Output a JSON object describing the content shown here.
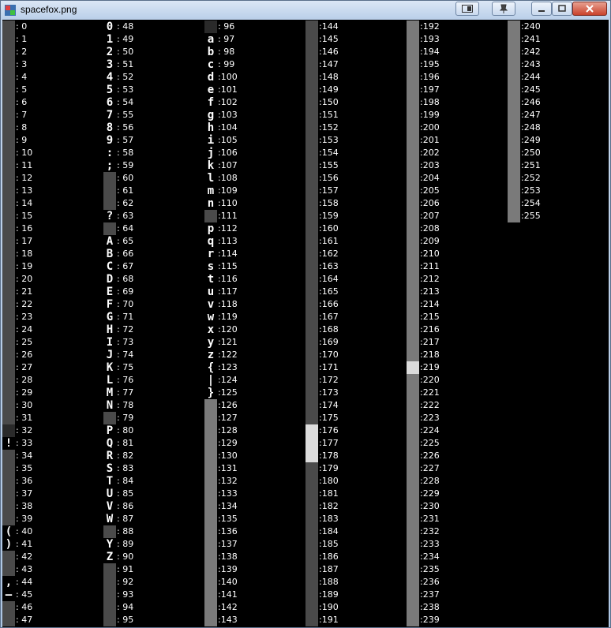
{
  "window": {
    "title": "spacefox.png",
    "buttons": {
      "fullscreen_icon": "window-toggle-icon",
      "pin_icon": "pin-icon",
      "minimize_icon": "minimize-icon",
      "maximize_icon": "maximize-icon",
      "close_icon": "close-icon"
    }
  },
  "tileset": {
    "glyphs": {
      "48": "0",
      "49": "1",
      "50": "2",
      "51": "3",
      "52": "4",
      "53": "5",
      "54": "6",
      "55": "7",
      "56": "8",
      "57": "9",
      "58": ":",
      "59": ";",
      "63": "?",
      "65": "A",
      "66": "B",
      "67": "C",
      "68": "D",
      "69": "E",
      "70": "F",
      "71": "G",
      "72": "H",
      "73": "I",
      "74": "J",
      "75": "K",
      "76": "L",
      "77": "M",
      "78": "N",
      "80": "P",
      "81": "Q",
      "82": "R",
      "83": "S",
      "84": "T",
      "85": "U",
      "86": "V",
      "87": "W",
      "89": "Y",
      "90": "Z",
      "97": "a",
      "98": "b",
      "99": "c",
      "100": "d",
      "101": "e",
      "102": "f",
      "103": "g",
      "104": "h",
      "105": "i",
      "106": "j",
      "107": "k",
      "108": "l",
      "109": "m",
      "110": "n",
      "112": "p",
      "113": "q",
      "114": "r",
      "115": "s",
      "116": "t",
      "117": "u",
      "118": "v",
      "119": "w",
      "120": "x",
      "121": "y",
      "122": "z",
      "123": "{",
      "124": "|",
      "125": "}",
      "33": "!",
      "40": "(",
      "41": ")",
      "44": ",",
      "45": "—"
    },
    "labels": [
      ": 0",
      ": 1",
      ": 2",
      ": 3",
      ": 4",
      ": 5",
      ": 6",
      ": 7",
      ": 8",
      ": 9",
      ": 10",
      ": 11",
      ": 12",
      ": 13",
      ": 14",
      ": 15",
      ": 16",
      ": 17",
      ": 18",
      ": 19",
      ": 20",
      ": 21",
      ": 22",
      ": 23",
      ": 24",
      ": 25",
      ": 26",
      ": 27",
      ": 28",
      ": 29",
      ": 30",
      ": 31",
      ": 32",
      ": 33",
      ": 34",
      ": 35",
      ": 36",
      ": 37",
      ": 38",
      ": 39",
      ": 40",
      ": 41",
      ": 42",
      ": 43",
      ": 44",
      ": 45",
      ": 46",
      ": 47",
      ": 48",
      ": 49",
      ": 50",
      ": 51",
      ": 52",
      ": 53",
      ": 54",
      ": 55",
      ": 56",
      ": 57",
      ": 58",
      ": 59",
      ": 60",
      ": 61",
      ": 62",
      ": 63",
      ": 64",
      ": 65",
      ": 66",
      ": 67",
      ": 68",
      ": 69",
      ": 70",
      ": 71",
      ": 72",
      ": 73",
      ": 74",
      ": 75",
      ": 76",
      ": 77",
      ": 78",
      ": 79",
      ": 80",
      ": 81",
      ": 82",
      ": 83",
      ": 84",
      ": 85",
      ": 86",
      ": 87",
      ": 88",
      ": 89",
      ": 90",
      ": 91",
      ": 92",
      ": 93",
      ": 94",
      ": 95",
      ": 96",
      ": 97",
      ": 98",
      ": 99",
      ":100",
      ":101",
      ":102",
      ":103",
      ":104",
      ":105",
      ":106",
      ":107",
      ":108",
      ":109",
      ":110",
      ":111",
      ":112",
      ":113",
      ":114",
      ":115",
      ":116",
      ":117",
      ":118",
      ":119",
      ":120",
      ":121",
      ":122",
      ":123",
      ":124",
      ":125",
      ":126",
      ":127",
      ":128",
      ":129",
      ":130",
      ":131",
      ":132",
      ":133",
      ":134",
      ":135",
      ":136",
      ":137",
      ":138",
      ":139",
      ":140",
      ":141",
      ":142",
      ":143",
      ":144",
      ":145",
      ":146",
      ":147",
      ":148",
      ":149",
      ":150",
      ":151",
      ":152",
      ":153",
      ":154",
      ":155",
      ":156",
      ":157",
      ":158",
      ":159",
      ":160",
      ":161",
      ":162",
      ":163",
      ":164",
      ":165",
      ":166",
      ":167",
      ":168",
      ":169",
      ":170",
      ":171",
      ":172",
      ":173",
      ":174",
      ":175",
      ":176",
      ":177",
      ":178",
      ":179",
      ":180",
      ":181",
      ":182",
      ":183",
      ":184",
      ":185",
      ":186",
      ":187",
      ":188",
      ":189",
      ":190",
      ":191",
      ":192",
      ":193",
      ":194",
      ":195",
      ":196",
      ":197",
      ":198",
      ":199",
      ":200",
      ":201",
      ":202",
      ":203",
      ":204",
      ":205",
      ":206",
      ":207",
      ":208",
      ":209",
      ":210",
      ":211",
      ":212",
      ":213",
      ":214",
      ":215",
      ":216",
      ":217",
      ":218",
      ":219",
      ":220",
      ":221",
      ":222",
      ":223",
      ":224",
      ":225",
      ":226",
      ":227",
      ":228",
      ":229",
      ":230",
      ":231",
      ":232",
      ":233",
      ":234",
      ":235",
      ":236",
      ":237",
      ":238",
      ":239",
      ":240",
      ":241",
      ":242",
      ":243",
      ":244",
      ":245",
      ":246",
      ":247",
      ":248",
      ":249",
      ":250",
      ":251",
      ":252",
      ":253",
      ":254",
      ":255"
    ]
  },
  "colors": {
    "background": "#000000",
    "label_text": "#ffffff",
    "tile_dark": "#4a4a4a",
    "tile_light": "#7a7a7a"
  }
}
